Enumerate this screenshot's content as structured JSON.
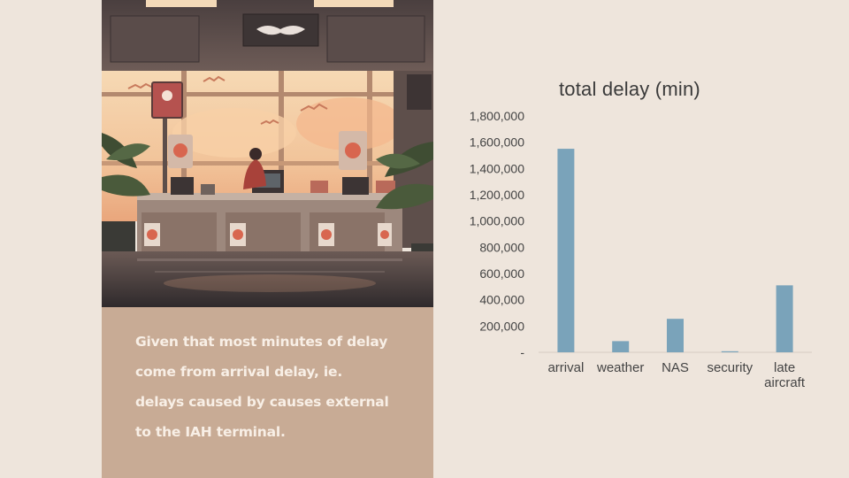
{
  "caption": {
    "lines": [
      "Given that most minutes of delay",
      "come from arrival delay, ie.",
      "delays caused by causes external",
      "to the IAH terminal."
    ]
  },
  "colors": {
    "background": "#eee5dc",
    "caption_panel": "#c8ab95",
    "bar": "#7aa3ba"
  },
  "chart_data": {
    "type": "bar",
    "title": "total delay (min)",
    "categories": [
      [
        "arrival"
      ],
      [
        "weather"
      ],
      [
        "NAS"
      ],
      [
        "security"
      ],
      [
        "late",
        "aircraft"
      ]
    ],
    "values": [
      1550000,
      85000,
      255000,
      8000,
      510000
    ],
    "ylim": [
      0,
      1800000
    ],
    "yticks": [
      "-",
      "200,000",
      "400,000",
      "600,000",
      "800,000",
      "1,000,000",
      "1,200,000",
      "1,400,000",
      "1,600,000",
      "1,800,000"
    ],
    "grid": false,
    "legend": "none"
  }
}
